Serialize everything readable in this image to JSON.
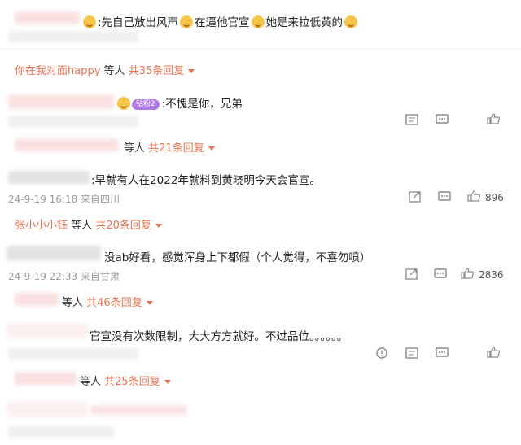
{
  "comments": [
    {
      "text": ":先自己放出风声",
      "text2": "在逼他官宣",
      "text3": "她是来拉低黄的",
      "reply_who": "你在我对面happy",
      "reply_mid": "等人",
      "reply_count": "共35条回复"
    },
    {
      "badge": "钻粉2",
      "text": ":不愧是你，兄弟",
      "reply_mid": "等人",
      "reply_count": "共21条回复"
    },
    {
      "text": ":早就有人在2022年就料到黄晓明今天会官宣。",
      "meta": "24-9-19 16:18 来自四川",
      "likes": "896",
      "reply_who": "张小小小钰",
      "reply_mid": "等人",
      "reply_count": "共20条回复"
    },
    {
      "text": "没ab好看，感觉浑身上下都假（个人觉得，不喜勿喷）",
      "meta": "24-9-19 22:33 来自甘肃",
      "likes": "2836",
      "reply_mid": "等人",
      "reply_count": "共46条回复"
    },
    {
      "text": "官宣没有次数限制，大大方方就好。不过品位。。。。。。",
      "reply_mid": "等人",
      "reply_count": "共25条回复"
    }
  ],
  "icons": {
    "share": "share-icon",
    "comment": "comment-icon",
    "like": "thumbs-up-icon",
    "report": "report-icon"
  }
}
